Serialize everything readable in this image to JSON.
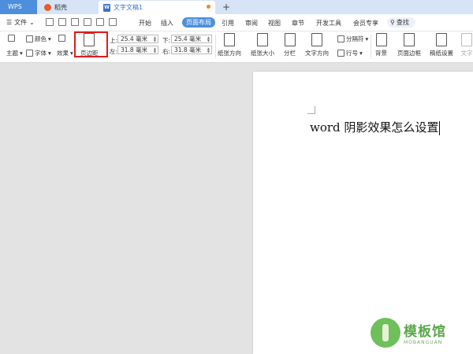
{
  "tabs": {
    "wps": "WPS",
    "shell": "稻壳",
    "document": "文字文稿1",
    "new_tab": "+"
  },
  "menu": {
    "file": "文件",
    "items": [
      "开始",
      "插入",
      "页面布局",
      "引用",
      "审阅",
      "视图",
      "章节",
      "开发工具",
      "会员专享"
    ],
    "active": "页面布局",
    "search": "查找"
  },
  "ribbon": {
    "theme": "主题",
    "color": "颜色",
    "font": "字体",
    "effect": "效果",
    "margins": "页边距",
    "margin_top_label": "上:",
    "margin_top": "25.4 毫米",
    "margin_bottom_label": "下:",
    "margin_bottom": "25.4 毫米",
    "margin_left_label": "左:",
    "margin_left": "31.8 毫米",
    "margin_right_label": "右:",
    "margin_right": "31.8 毫米",
    "orientation": "纸张方向",
    "size": "纸张大小",
    "columns": "分栏",
    "text_direction": "文字方向",
    "separator": "分隔符",
    "line_number": "行号",
    "background": "背景",
    "page_border": "页面边框",
    "paper_setup": "稿纸设置",
    "text_overflow": "文字"
  },
  "document": {
    "text": "word 阴影效果怎么设置"
  },
  "watermark": {
    "brand_cn": "模板馆",
    "brand_en": "MOBANGUAN"
  },
  "colors": {
    "accent": "#4d8fdc",
    "highlight": "#e01b1b"
  }
}
